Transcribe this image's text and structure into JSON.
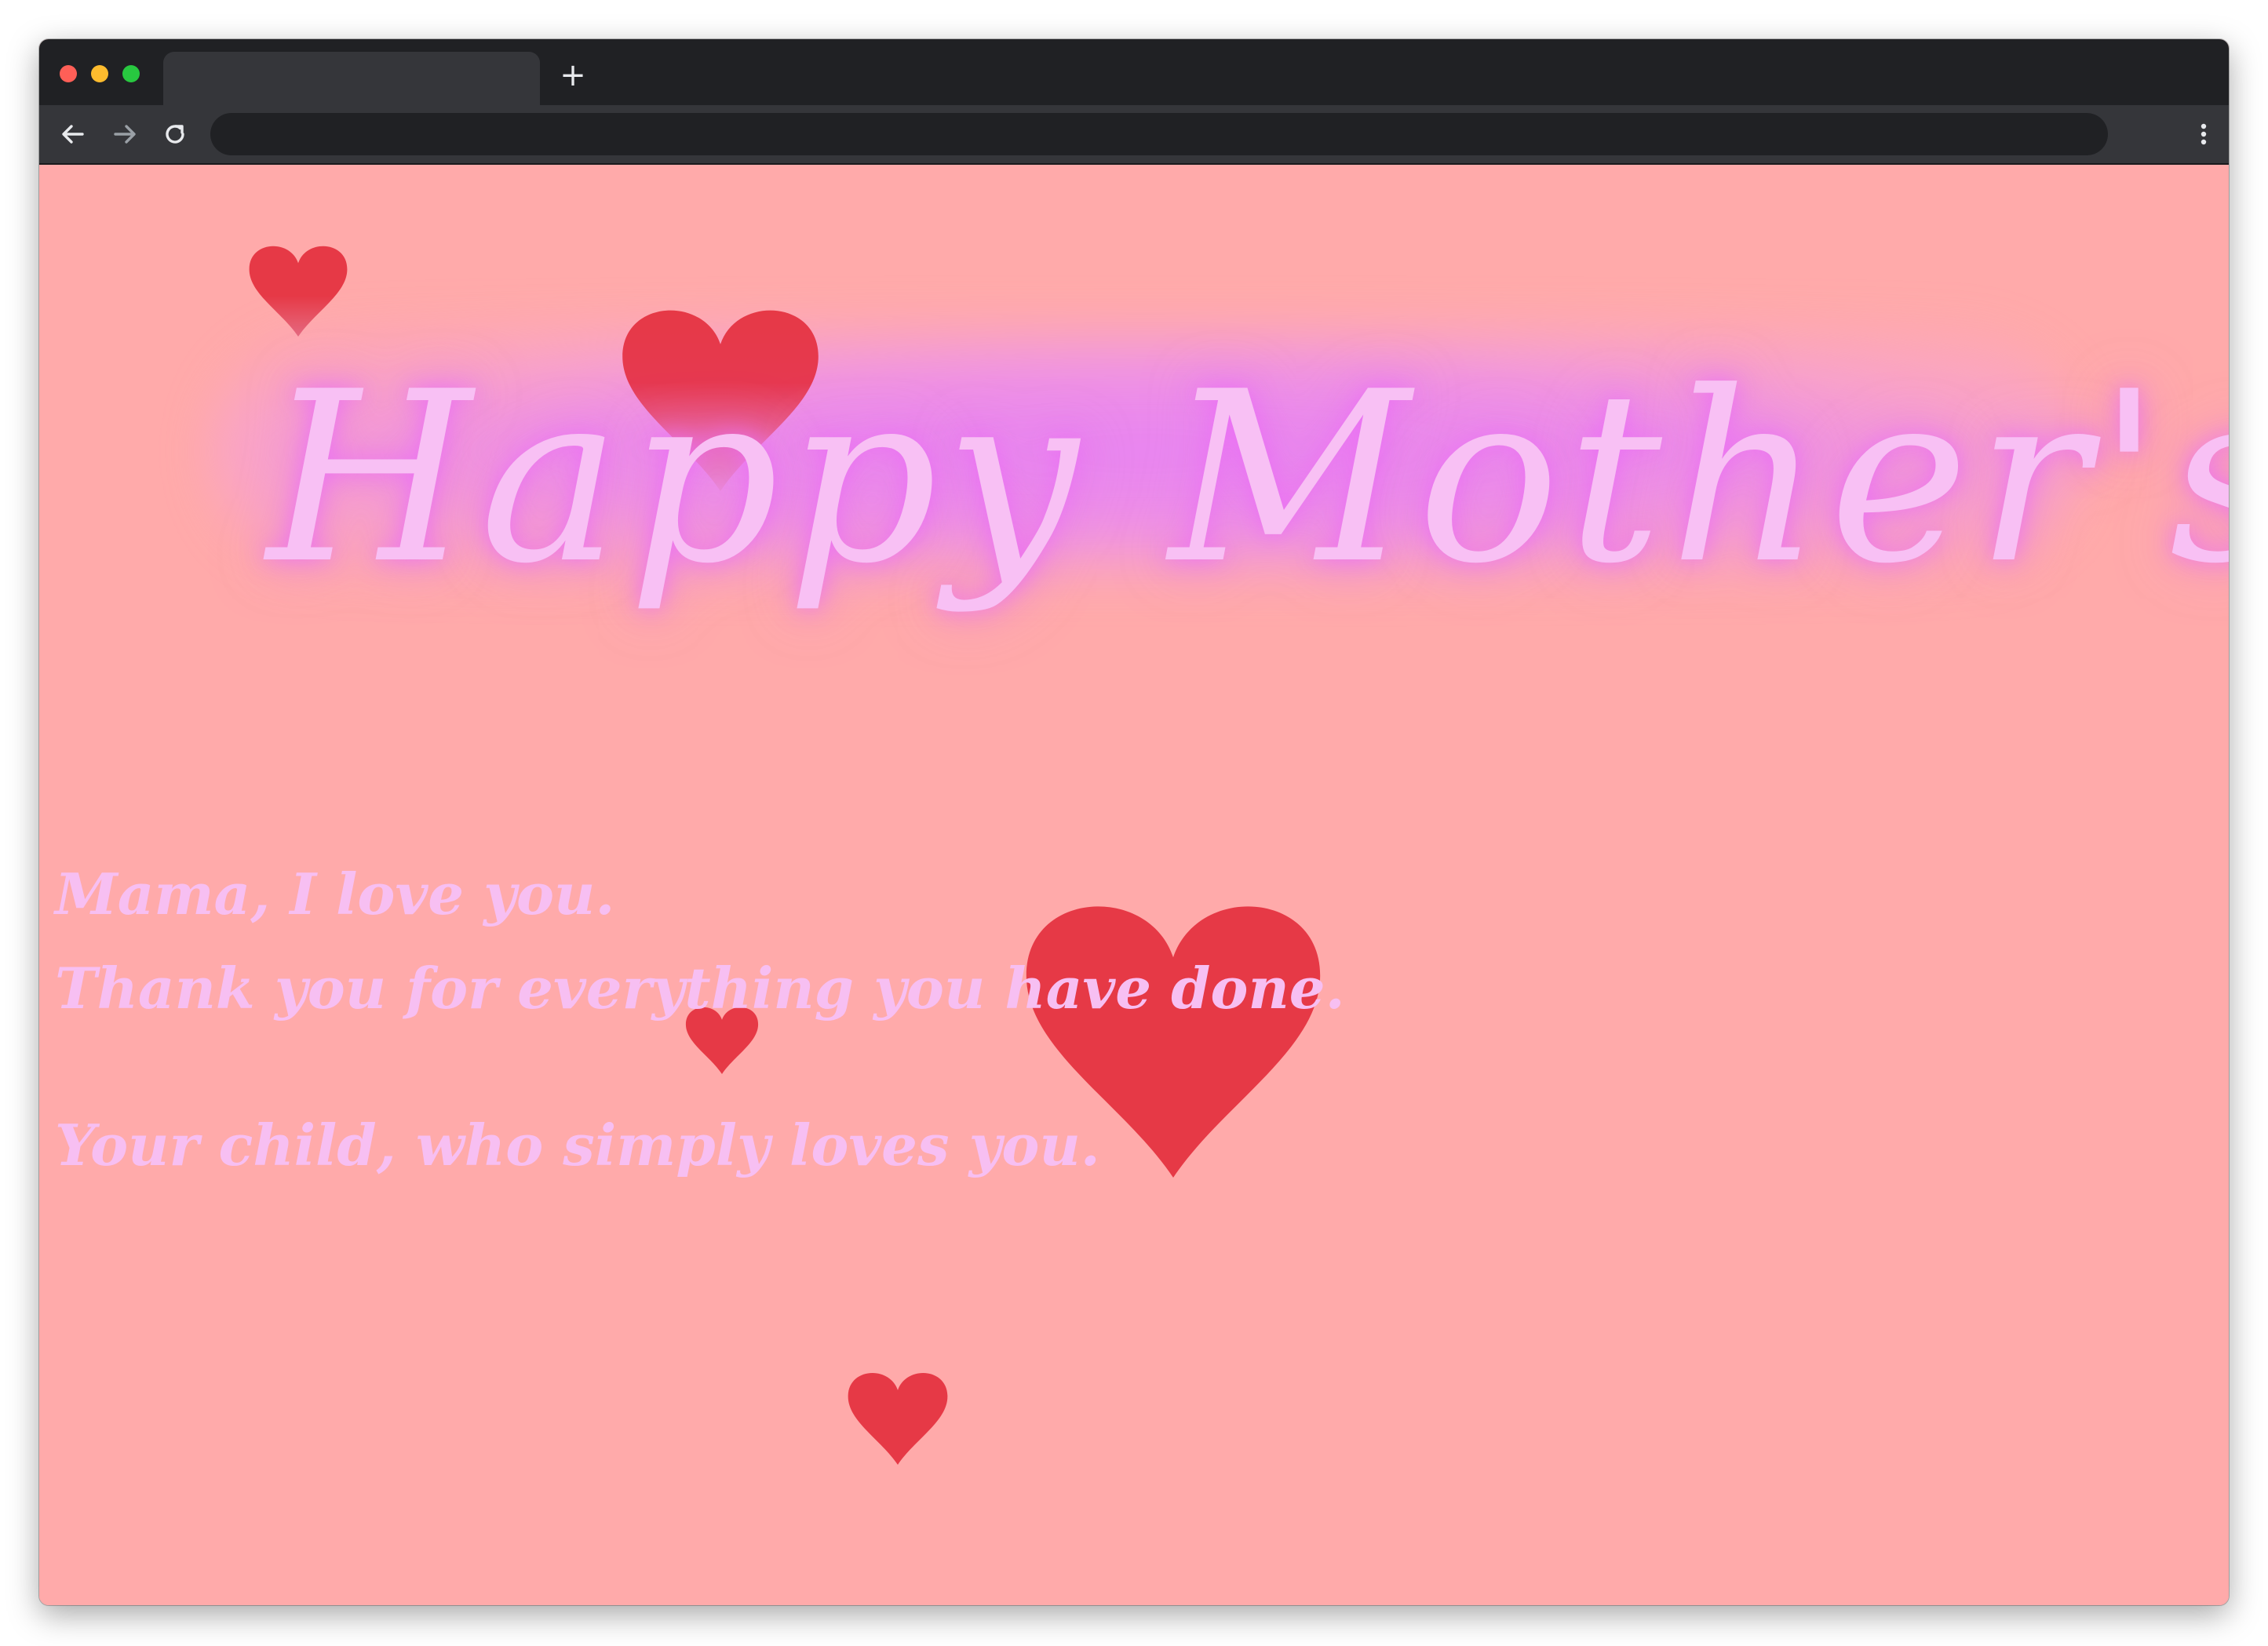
{
  "browser": {
    "tab_title": "",
    "new_tab_label": "+",
    "address": ""
  },
  "page": {
    "heading": "Happy Mother's Day",
    "lines": [
      "Mama, I love you.",
      "Thank you for everything you have done.",
      "Your child, who simply loves you."
    ]
  },
  "colors": {
    "background": "#ffaaaa",
    "heart": "#e63946",
    "text": "#f7bff2",
    "glow": "#e682f5"
  },
  "icons": {
    "back": "arrow-left-icon",
    "forward": "arrow-right-icon",
    "reload": "reload-icon",
    "menu": "kebab-menu-icon",
    "decoration": "heart-icon"
  }
}
